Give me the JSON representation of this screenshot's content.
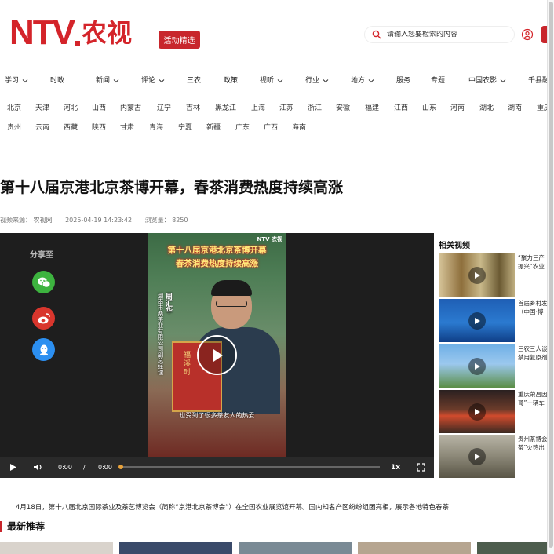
{
  "header": {
    "logo_en": "NTV",
    "logo_cn": "农视",
    "activity_label": "活动精选",
    "search_placeholder": "请输入您要检索的内容"
  },
  "nav": [
    {
      "label": "学习",
      "dropdown": true
    },
    {
      "label": "时政",
      "dropdown": false
    },
    {
      "label": "新闻",
      "dropdown": true
    },
    {
      "label": "评论",
      "dropdown": true
    },
    {
      "label": "三农",
      "dropdown": false
    },
    {
      "label": "政策",
      "dropdown": false
    },
    {
      "label": "视听",
      "dropdown": true
    },
    {
      "label": "行业",
      "dropdown": true
    },
    {
      "label": "地方",
      "dropdown": true
    },
    {
      "label": "服务",
      "dropdown": false
    },
    {
      "label": "专题",
      "dropdown": false
    },
    {
      "label": "中国农影",
      "dropdown": true
    },
    {
      "label": "千县融",
      "dropdown": false
    }
  ],
  "regions_row1": [
    "北京",
    "天津",
    "河北",
    "山西",
    "内蒙古",
    "辽宁",
    "吉林",
    "黑龙江",
    "上海",
    "江苏",
    "浙江",
    "安徽",
    "福建",
    "江西",
    "山东",
    "河南",
    "湖北",
    "湖南",
    "重庆"
  ],
  "regions_row2": [
    "贵州",
    "云南",
    "西藏",
    "陕西",
    "甘肃",
    "青海",
    "宁夏",
    "新疆",
    "广东",
    "广西",
    "海南"
  ],
  "article": {
    "title": "第十八届京港北京茶博开幕，春茶消费热度持续高涨",
    "source": "视频来源： 农视网",
    "datetime": "2025-04-19 14:23:42",
    "views": "浏览量： 8250",
    "body": "4月18日，第十八届北京国际茶业及茶艺博览会（简称“京港北京茶博会”）在全国农业展览馆开幕。国内知名产区纷纷组团亮相，展示各地特色春茶"
  },
  "video": {
    "share_label": "分享至",
    "poster_logo": "NTV 农视",
    "poster_title_line1": "第十八届京港北京茶博开幕",
    "poster_title_line2": "春茶消费热度持续高涨",
    "poster_name": "周汇华",
    "poster_role": "湖南市桑茶业有限公司副总经理",
    "poster_subtitle": "也受到了很多茶友人的热爱",
    "book_text": "福溪时",
    "time_current": "0:00",
    "time_separator": "/",
    "time_total": "0:00",
    "speed": "1x",
    "progress": 0
  },
  "related": {
    "title": "相关视频",
    "items": [
      {
        "text_line1": "“聚力三产",
        "text_line2": "振兴”农业"
      },
      {
        "text_line1": "首届乡村发",
        "text_line2": "（中国·博"
      },
      {
        "text_line1": "三农三人谈",
        "text_line2": "禁用复原剂"
      },
      {
        "text_line1": "重庆荣昌因",
        "text_line2": "哥”一辆车"
      },
      {
        "text_line1": "贵州茶博会",
        "text_line2": "茶”火热出"
      }
    ]
  },
  "recommend_title": "最新推荐",
  "colors": {
    "brand_red": "#d4242a",
    "progress": "#e8a23a"
  }
}
